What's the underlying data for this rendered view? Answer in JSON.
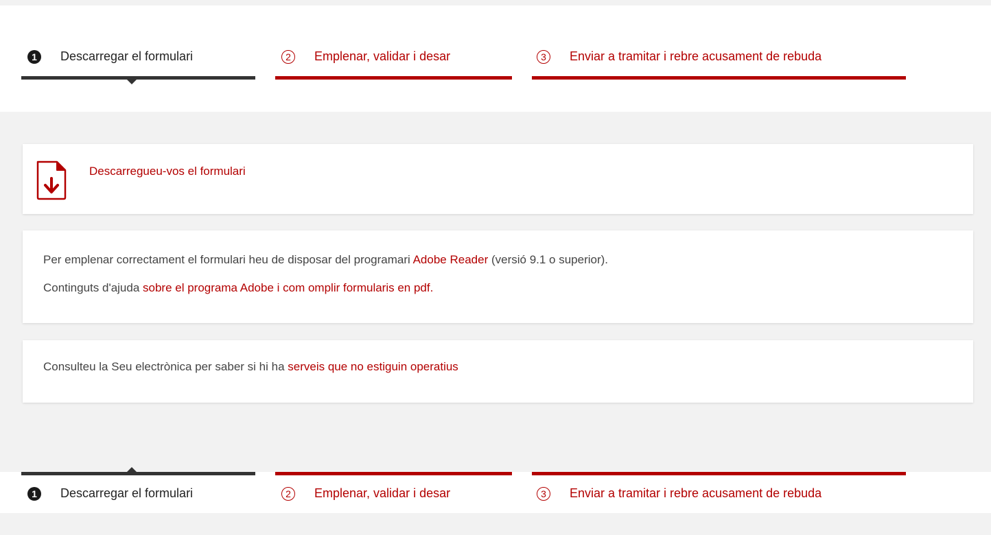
{
  "steps": [
    {
      "number": "1",
      "label": "Descarregar el formulari",
      "state": "active"
    },
    {
      "number": "2",
      "label": "Emplenar, validar i desar",
      "state": "inactive"
    },
    {
      "number": "3",
      "label": "Enviar a tramitar i rebre acusament de rebuda",
      "state": "inactive"
    }
  ],
  "download": {
    "link": "Descarregueu-vos el formulari",
    "icon": "pdf-download-icon"
  },
  "info": {
    "line1_before": "Per emplenar correctament el formulari heu de disposar del programari ",
    "line1_link": "Adobe Reader",
    "line1_after": " (versió 9.1 o superior).",
    "line2_before": "Continguts d'ajuda ",
    "line2_link": "sobre el programa Adobe i com omplir formularis en pdf."
  },
  "status": {
    "before": "Consulteu la Seu electrònica per saber si hi ha ",
    "link": "serveis que no estiguin operatius"
  },
  "colors": {
    "accent": "#b30000",
    "active": "#333333",
    "background": "#f2f2f2"
  }
}
